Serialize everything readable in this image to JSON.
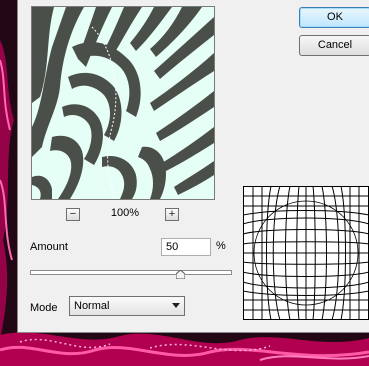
{
  "dialog": {
    "ok_label": "OK",
    "cancel_label": "Cancel"
  },
  "zoom": {
    "level": "100%",
    "minus_symbol": "−",
    "plus_symbol": "+"
  },
  "amount": {
    "label": "Amount",
    "value": "50",
    "unit": "%",
    "slider_fraction": 0.75
  },
  "mode": {
    "label": "Mode",
    "selected": "Normal"
  },
  "icons": {
    "dropdown": "chevron-down-icon"
  }
}
